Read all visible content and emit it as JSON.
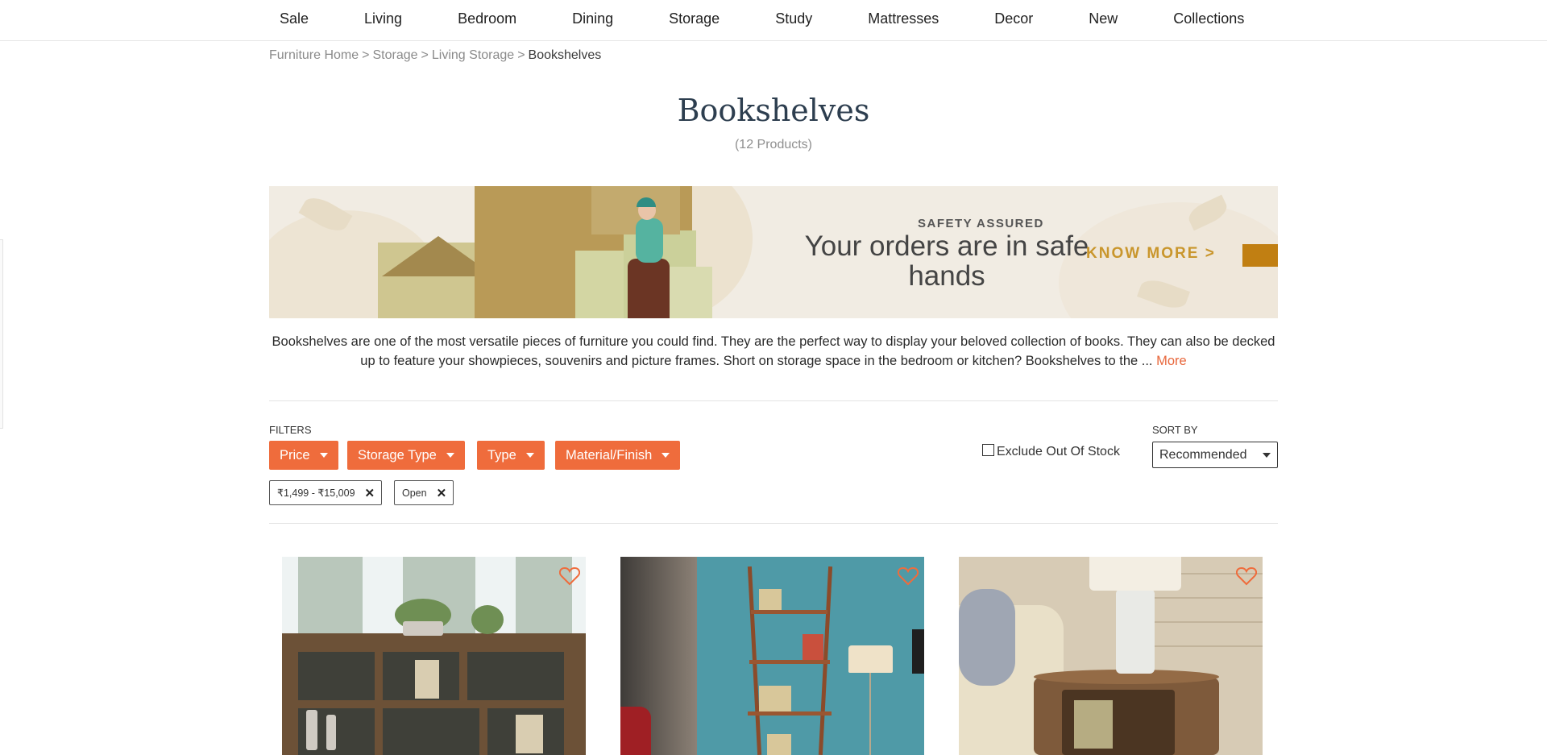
{
  "nav": {
    "items": [
      "Sale",
      "Living",
      "Bedroom",
      "Dining",
      "Storage",
      "Study",
      "Mattresses",
      "Decor",
      "New",
      "Collections"
    ]
  },
  "breadcrumb": {
    "items": [
      "Furniture Home",
      "Storage",
      "Living Storage"
    ],
    "current": "Bookshelves",
    "separator": ">"
  },
  "page": {
    "title": "Bookshelves",
    "count": "(12 Products)"
  },
  "banner": {
    "eyebrow": "SAFETY ASSURED",
    "headline": "Your orders are in safe hands",
    "cta": "KNOW MORE >"
  },
  "description": {
    "text": "Bookshelves are one of the most versatile pieces of furniture you could find. They are the perfect way to display your beloved collection of books. They can also be decked up to feature your showpieces, souvenirs and picture frames. Short on storage space in the bedroom or kitchen? Bookshelves to the ...",
    "more": "More"
  },
  "filters": {
    "label": "FILTERS",
    "buttons": [
      "Price",
      "Storage Type",
      "Type",
      "Material/Finish"
    ],
    "applied": [
      "₹1,499 - ₹15,009",
      "Open"
    ],
    "exclude_out_of_stock": {
      "label": "Exclude Out Of Stock",
      "checked": false
    }
  },
  "sort": {
    "label": "SORT BY",
    "selected": "Recommended"
  },
  "products": [
    {
      "wishlisted": false
    },
    {
      "wishlisted": false
    },
    {
      "wishlisted": false
    }
  ],
  "colors": {
    "accent": "#ef6c3c",
    "title": "#2d3e4f",
    "banner_cta": "#c9962c"
  },
  "icons": {
    "wishlist": "heart-outline-icon",
    "remove_chip": "close-icon",
    "dropdown": "caret-down-icon"
  }
}
